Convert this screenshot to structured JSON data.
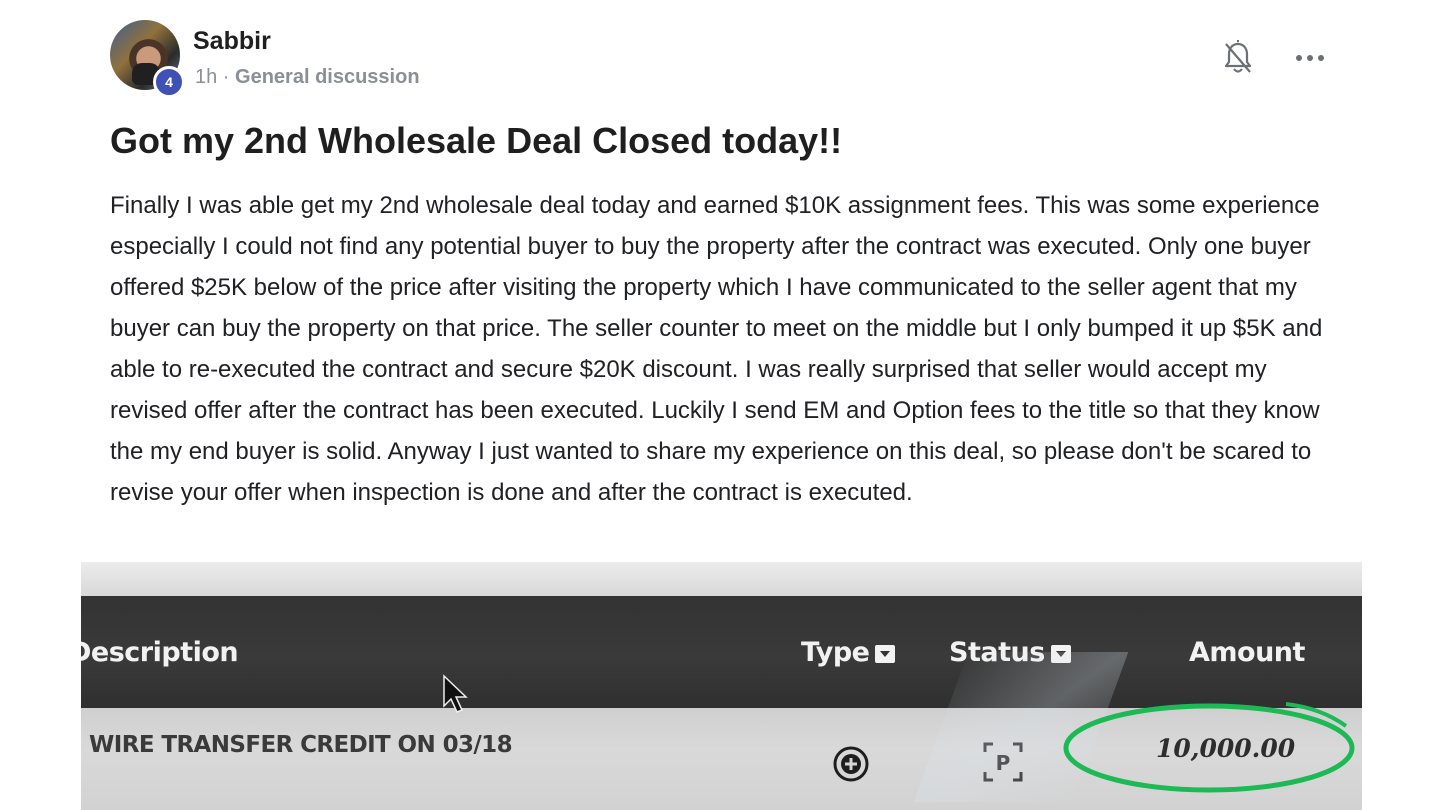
{
  "post": {
    "author": {
      "name": "Sabbir",
      "level": "4"
    },
    "meta": {
      "time": "1h",
      "separator": " · ",
      "category": "General discussion"
    },
    "title": "Got my 2nd Wholesale Deal Closed today!!",
    "body": "Finally I was able get my 2nd wholesale deal today and earned $10K assignment fees. This was some experience especially I could not find any potential buyer to buy the property after the contract was executed. Only one buyer offered $25K below of the price after visiting the property which I have communicated to the seller agent that my buyer can buy the property on that price. The seller counter to meet on the middle but I only bumped it up $5K and able to re-executed the contract and secure $20K discount. I was really surprised that seller would accept my revised offer after the contract has been executed. Luckily I send EM and Option fees to the title so that they know the my end buyer is solid. Anyway I just wanted to share my experience on this deal, so please don't be scared to revise your offer when inspection is done and after the contract is executed.",
    "actions": {
      "bell_icon": "bell-off-icon",
      "more_icon": "more-horizontal-icon"
    }
  },
  "attachment": {
    "columns": {
      "description": "Description",
      "type": "Type",
      "status": "Status",
      "amount": "Amount"
    },
    "row": {
      "description": "WIRE TRANSFER CREDIT ON 03/18",
      "type_icon": "plus-circle-icon",
      "status": "P",
      "amount": "10,000.00"
    },
    "highlight_color": "#1db954"
  },
  "colors": {
    "level_badge": "#3f51b5",
    "meta_text": "#8b8f96",
    "table_header_bg": "#333333"
  }
}
